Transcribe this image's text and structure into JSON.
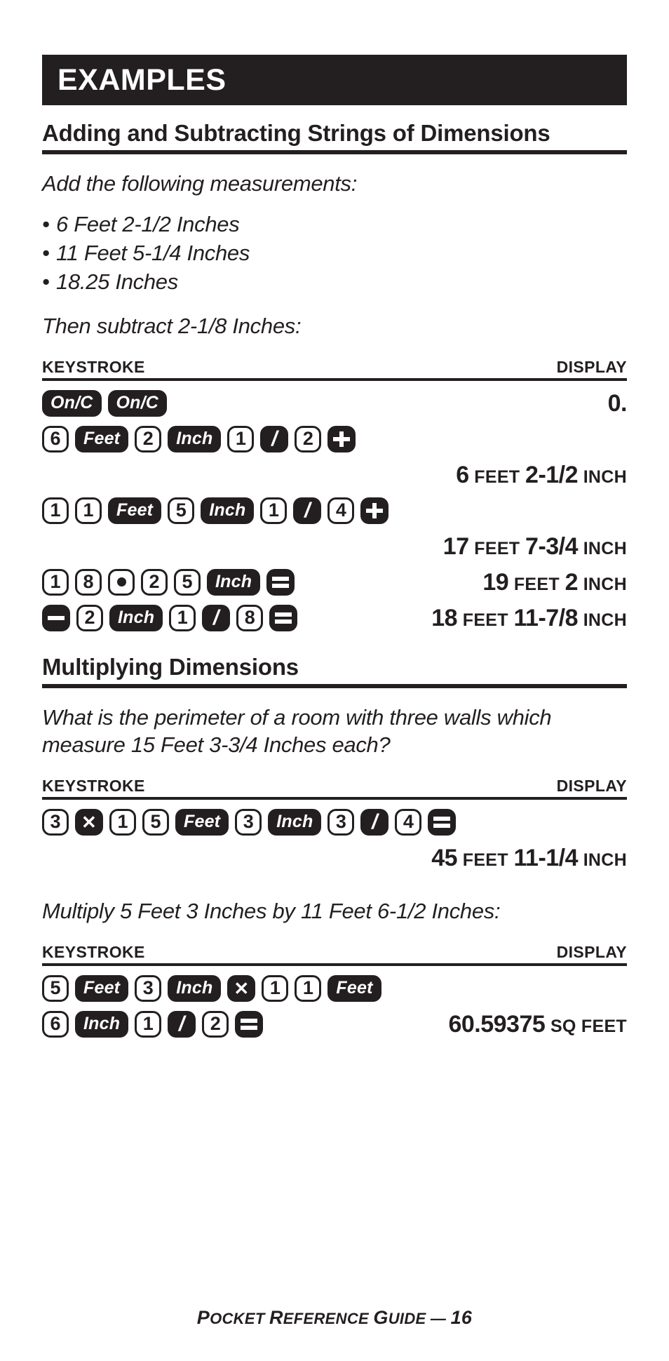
{
  "banner": {
    "title": "EXAMPLES"
  },
  "section1": {
    "heading": "Adding and Subtracting Strings of Dimensions",
    "intro": "Add the following measurements:",
    "bullets": [
      "6 Feet 2-1/2 Inches",
      "11 Feet 5-1/4 Inches",
      "18.25 Inches"
    ],
    "then": "Then subtract 2-1/8 Inches:",
    "table_header": {
      "keystroke": "KEYSTROKE",
      "display": "DISPLAY"
    },
    "rows": [
      {
        "keys": [
          {
            "type": "op",
            "label": "On/C"
          },
          {
            "type": "op",
            "label": "On/C"
          }
        ],
        "display": {
          "value": "0.",
          "unit": ""
        }
      },
      {
        "keys": [
          {
            "type": "num",
            "label": "6"
          },
          {
            "type": "op",
            "label": "Feet"
          },
          {
            "type": "num",
            "label": "2"
          },
          {
            "type": "op",
            "label": "Inch"
          },
          {
            "type": "num",
            "label": "1"
          },
          {
            "type": "slash",
            "label": "/"
          },
          {
            "type": "num",
            "label": "2"
          },
          {
            "type": "plus",
            "label": "+"
          }
        ],
        "display": null
      },
      {
        "keys": [],
        "display_parts": [
          {
            "kind": "big",
            "text": "6"
          },
          {
            "kind": "unit",
            "text": "FEET"
          },
          {
            "kind": "big",
            "text": "2-1/2"
          },
          {
            "kind": "unit",
            "text": "INCH"
          }
        ]
      },
      {
        "keys": [
          {
            "type": "num",
            "label": "1"
          },
          {
            "type": "num",
            "label": "1"
          },
          {
            "type": "op",
            "label": "Feet"
          },
          {
            "type": "num",
            "label": "5"
          },
          {
            "type": "op",
            "label": "Inch"
          },
          {
            "type": "num",
            "label": "1"
          },
          {
            "type": "slash",
            "label": "/"
          },
          {
            "type": "num",
            "label": "4"
          },
          {
            "type": "plus",
            "label": "+"
          }
        ],
        "display": null
      },
      {
        "keys": [],
        "display_parts": [
          {
            "kind": "big",
            "text": "17"
          },
          {
            "kind": "unit",
            "text": "FEET"
          },
          {
            "kind": "big",
            "text": "7-3/4"
          },
          {
            "kind": "unit",
            "text": "INCH"
          }
        ]
      },
      {
        "keys": [
          {
            "type": "num",
            "label": "1"
          },
          {
            "type": "num",
            "label": "8"
          },
          {
            "type": "dot",
            "label": "."
          },
          {
            "type": "num",
            "label": "2"
          },
          {
            "type": "num",
            "label": "5"
          },
          {
            "type": "op",
            "label": "Inch"
          },
          {
            "type": "eq",
            "label": "="
          }
        ],
        "display_parts": [
          {
            "kind": "big",
            "text": "19"
          },
          {
            "kind": "unit",
            "text": "FEET"
          },
          {
            "kind": "big",
            "text": "2"
          },
          {
            "kind": "unit",
            "text": "INCH"
          }
        ]
      },
      {
        "keys": [
          {
            "type": "minus",
            "label": "-"
          },
          {
            "type": "num",
            "label": "2"
          },
          {
            "type": "op",
            "label": "Inch"
          },
          {
            "type": "num",
            "label": "1"
          },
          {
            "type": "slash",
            "label": "/"
          },
          {
            "type": "num",
            "label": "8"
          },
          {
            "type": "eq",
            "label": "="
          }
        ],
        "display_parts": [
          {
            "kind": "big",
            "text": "18"
          },
          {
            "kind": "unit",
            "text": "FEET"
          },
          {
            "kind": "big",
            "text": "11-7/8"
          },
          {
            "kind": "unit",
            "text": "INCH"
          }
        ]
      }
    ]
  },
  "section2": {
    "heading": "Multiplying Dimensions",
    "intro": "What is the perimeter of a room with three walls which measure 15 Feet 3-3/4 Inches each?",
    "table_header": {
      "keystroke": "KEYSTROKE",
      "display": "DISPLAY"
    },
    "rows": [
      {
        "keys": [
          {
            "type": "num",
            "label": "3"
          },
          {
            "type": "times",
            "label": "×"
          },
          {
            "type": "num",
            "label": "1"
          },
          {
            "type": "num",
            "label": "5"
          },
          {
            "type": "op",
            "label": "Feet"
          },
          {
            "type": "num",
            "label": "3"
          },
          {
            "type": "op",
            "label": "Inch"
          },
          {
            "type": "num",
            "label": "3"
          },
          {
            "type": "slash",
            "label": "/"
          },
          {
            "type": "num",
            "label": "4"
          },
          {
            "type": "eq",
            "label": "="
          }
        ],
        "display": null
      },
      {
        "keys": [],
        "display_parts": [
          {
            "kind": "big",
            "text": "45"
          },
          {
            "kind": "unit",
            "text": "FEET"
          },
          {
            "kind": "big",
            "text": "11-1/4"
          },
          {
            "kind": "unit",
            "text": "INCH"
          }
        ]
      }
    ],
    "intro2": "Multiply 5 Feet 3 Inches by 11 Feet 6-1/2 Inches:",
    "table_header2": {
      "keystroke": "KEYSTROKE",
      "display": "DISPLAY"
    },
    "rows2": [
      {
        "keys": [
          {
            "type": "num",
            "label": "5"
          },
          {
            "type": "op",
            "label": "Feet"
          },
          {
            "type": "num",
            "label": "3"
          },
          {
            "type": "op",
            "label": "Inch"
          },
          {
            "type": "times",
            "label": "×"
          },
          {
            "type": "num",
            "label": "1"
          },
          {
            "type": "num",
            "label": "1"
          },
          {
            "type": "op",
            "label": "Feet"
          }
        ],
        "display": null
      },
      {
        "keys": [
          {
            "type": "num",
            "label": "6"
          },
          {
            "type": "op",
            "label": "Inch"
          },
          {
            "type": "num",
            "label": "1"
          },
          {
            "type": "slash",
            "label": "/"
          },
          {
            "type": "num",
            "label": "2"
          },
          {
            "type": "eq",
            "label": "="
          }
        ],
        "display_parts": [
          {
            "kind": "big",
            "text": "60.59375"
          },
          {
            "kind": "unit",
            "text": "SQ FEET"
          }
        ]
      }
    ]
  },
  "footer": {
    "prefix_cap": "P",
    "text": "POCKET REFERENCE GUIDE — 16",
    "parts": [
      "P",
      "OCKET ",
      "R",
      "EFERENCE ",
      "G",
      "UIDE — ",
      "16"
    ]
  },
  "colors": {
    "ink": "#231f20",
    "paper": "#ffffff"
  }
}
